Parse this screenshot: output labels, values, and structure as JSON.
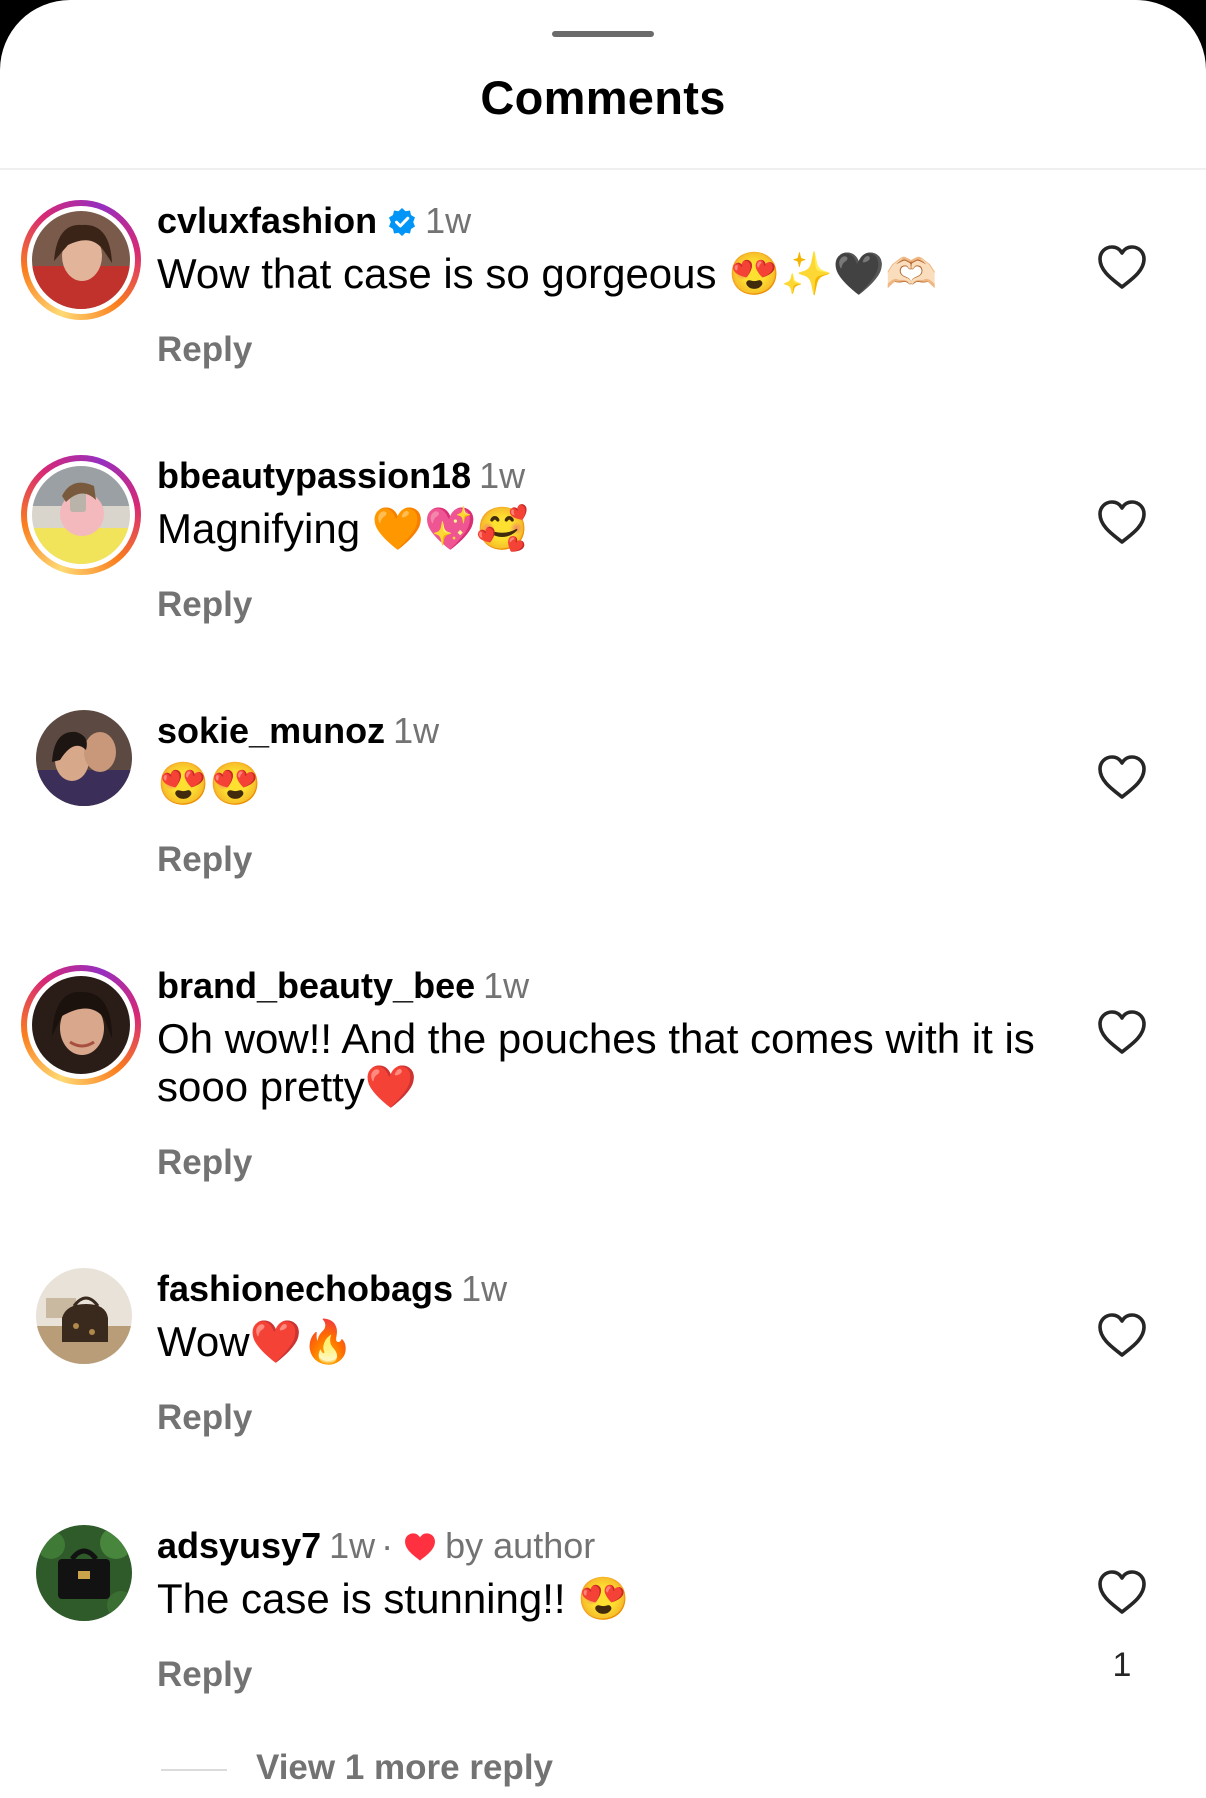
{
  "header": {
    "title": "Comments"
  },
  "comments": [
    {
      "username": "cvluxfashion",
      "verified": true,
      "time": "1w",
      "text": "Wow that case is so gorgeous 😍✨🖤🫶🏻",
      "reply": "Reply",
      "ring": true
    },
    {
      "username": "bbeautypassion18",
      "verified": false,
      "time": "1w",
      "text": "Magnifying 🧡💖🥰",
      "reply": "Reply",
      "ring": true
    },
    {
      "username": "sokie_munoz",
      "verified": false,
      "time": "1w",
      "text": "😍😍",
      "reply": "Reply",
      "ring": false
    },
    {
      "username": "brand_beauty_bee",
      "verified": false,
      "time": "1w",
      "text": "Oh wow!! And the pouches that comes with it is sooo pretty❤️",
      "reply": "Reply",
      "ring": true
    },
    {
      "username": "fashionechobags",
      "verified": false,
      "time": "1w",
      "text": "Wow❤️🔥",
      "reply": "Reply",
      "ring": false
    },
    {
      "username": "adsyusy7",
      "verified": false,
      "time": "1w",
      "dot": "·",
      "liked_by_author_label": "by author",
      "text": "The case is stunning!! 😍",
      "reply": "Reply",
      "ring": false,
      "like_count": "1"
    }
  ],
  "view_more": {
    "label": "View 1 more reply"
  },
  "colors": {
    "secondary_text": "#737373",
    "verified_blue": "#0095f6",
    "heart_red": "#ff3040"
  }
}
